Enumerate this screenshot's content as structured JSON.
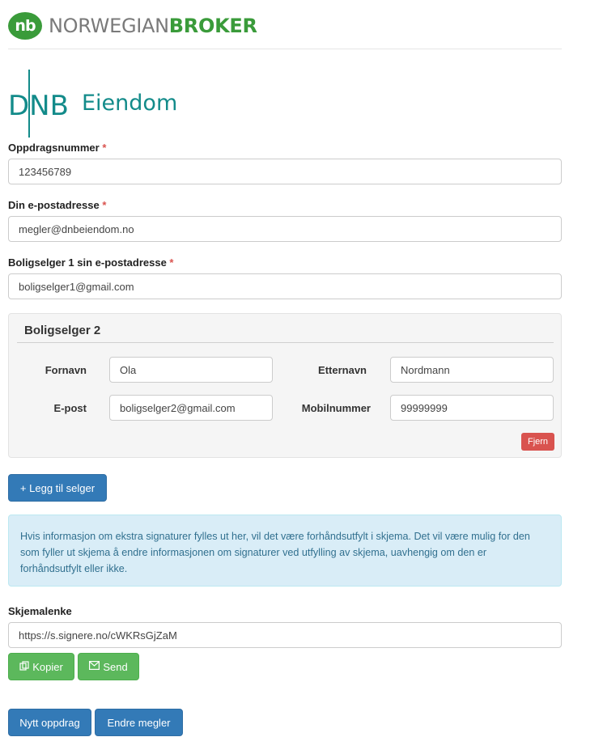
{
  "header": {
    "logo_text": "nb",
    "brand_part1": "NORWEGIAN",
    "brand_part2": "BROKER"
  },
  "office": {
    "logo_letters": "DNB",
    "name": "Eiendom"
  },
  "form": {
    "assignment_label": "Oppdragsnummer",
    "assignment_value": "123456789",
    "email_label": "Din e-postadresse",
    "email_value": "megler@dnbeiendom.no",
    "seller1_label": "Boligselger 1 sin e-postadresse",
    "seller1_value": "boligselger1@gmail.com",
    "required_mark": "*"
  },
  "seller2": {
    "title": "Boligselger 2",
    "firstname_label": "Fornavn",
    "firstname_value": "Ola",
    "lastname_label": "Etternavn",
    "lastname_value": "Nordmann",
    "email_label": "E-post",
    "email_value": "boligselger2@gmail.com",
    "mobile_label": "Mobilnummer",
    "mobile_value": "99999999",
    "remove_label": "Fjern"
  },
  "add_seller_label": "+ Legg til selger",
  "info_text": "Hvis informasjon om ekstra signaturer fylles ut her, vil det være forhåndsutfylt i skjema. Det vil være mulig for den som fyller ut skjema å endre informasjonen om signaturer ved utfylling av skjema, uavhengig om den er forhåndsutfylt eller ikke.",
  "link": {
    "label": "Skjemalenke",
    "value": "https://s.signere.no/cWKRsGjZaM",
    "copy_label": "Kopier",
    "send_label": "Send"
  },
  "actions": {
    "new_assignment_label": "Nytt oppdrag",
    "change_broker_label": "Endre megler"
  },
  "colors": {
    "brand_green": "#3a9b3a",
    "dnb_teal": "#138b8a",
    "primary": "#337ab7",
    "success": "#5cb85c",
    "danger": "#d9534f",
    "info_bg": "#d9edf7"
  }
}
